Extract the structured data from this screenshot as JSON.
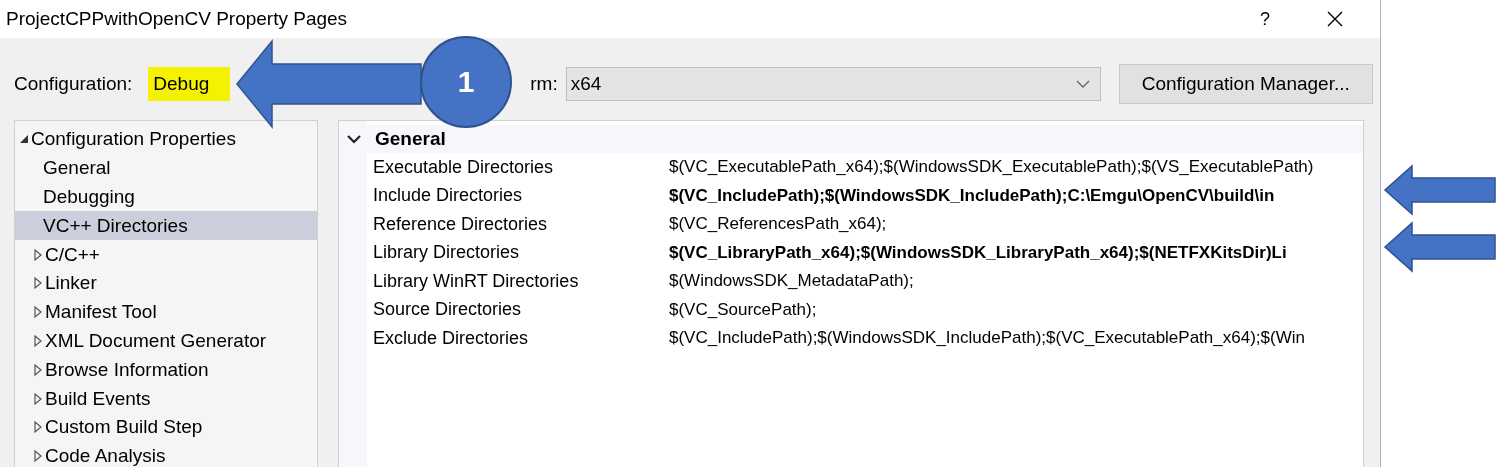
{
  "window": {
    "title": "ProjectCPPwithOpenCV Property Pages",
    "help": "?"
  },
  "configuration": {
    "label": "Configuration:",
    "value": "Debug",
    "highlighted": true
  },
  "platform": {
    "label": "rm:",
    "value": "x64"
  },
  "config_manager_button": "Configuration Manager...",
  "tree": [
    {
      "label": "Configuration Properties",
      "kind": "group",
      "expanded": true,
      "selected": false,
      "children": [
        {
          "label": "General",
          "kind": "page",
          "selected": false
        },
        {
          "label": "Debugging",
          "kind": "page",
          "selected": false
        },
        {
          "label": "VC++ Directories",
          "kind": "page",
          "selected": true
        },
        {
          "label": "C/C++",
          "kind": "group",
          "expanded": false,
          "selected": false
        },
        {
          "label": "Linker",
          "kind": "group",
          "expanded": false,
          "selected": false
        },
        {
          "label": "Manifest Tool",
          "kind": "group",
          "expanded": false,
          "selected": false
        },
        {
          "label": "XML Document Generator",
          "kind": "group",
          "expanded": false,
          "selected": false
        },
        {
          "label": "Browse Information",
          "kind": "group",
          "expanded": false,
          "selected": false
        },
        {
          "label": "Build Events",
          "kind": "group",
          "expanded": false,
          "selected": false
        },
        {
          "label": "Custom Build Step",
          "kind": "group",
          "expanded": false,
          "selected": false
        },
        {
          "label": "Code Analysis",
          "kind": "group",
          "expanded": false,
          "selected": false
        }
      ]
    }
  ],
  "property_grid": {
    "category": {
      "label": "General",
      "expanded": true
    },
    "rows": [
      {
        "name": "Executable Directories",
        "value": "$(VC_ExecutablePath_x64);$(WindowsSDK_ExecutablePath);$(VS_ExecutablePath)",
        "modified": false
      },
      {
        "name": "Include Directories",
        "value": "$(VC_IncludePath);$(WindowsSDK_IncludePath);C:\\Emgu\\OpenCV\\build\\in",
        "modified": true
      },
      {
        "name": "Reference Directories",
        "value": "$(VC_ReferencesPath_x64);",
        "modified": false
      },
      {
        "name": "Library Directories",
        "value": "$(VC_LibraryPath_x64);$(WindowsSDK_LibraryPath_x64);$(NETFXKitsDir)Li",
        "modified": true
      },
      {
        "name": "Library WinRT Directories",
        "value": "$(WindowsSDK_MetadataPath);",
        "modified": false
      },
      {
        "name": "Source Directories",
        "value": "$(VC_SourcePath);",
        "modified": false
      },
      {
        "name": "Exclude Directories",
        "value": "$(VC_IncludePath);$(WindowsSDK_IncludePath);$(VC_ExecutablePath_x64);$(Win",
        "modified": false
      }
    ]
  },
  "annotations": {
    "step_number": "1"
  }
}
